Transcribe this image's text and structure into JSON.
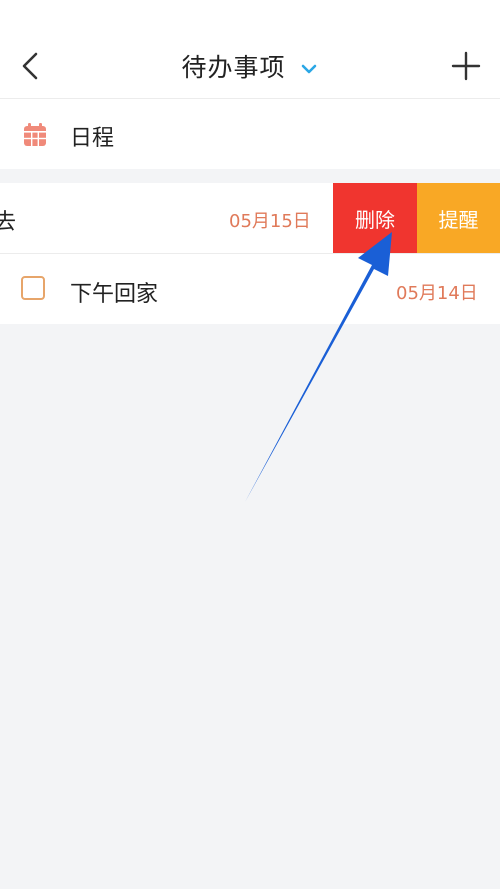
{
  "header": {
    "title": "待办事项",
    "back_icon": "chevron-left-icon",
    "dropdown_icon": "chevron-down-icon",
    "add_icon": "plus-icon"
  },
  "schedule": {
    "label": "日程",
    "icon": "calendar-icon",
    "icon_color": "#f08a7a"
  },
  "tasks": [
    {
      "text": "去",
      "date": "05月15日",
      "swiped": true
    },
    {
      "text": "下午回家",
      "date": "05月14日",
      "swiped": false
    }
  ],
  "swipe_actions": {
    "delete_label": "删除",
    "remind_label": "提醒",
    "delete_color": "#f0352f",
    "remind_color": "#f9a825"
  },
  "colors": {
    "accent": "#2aa7e6",
    "date": "#e07a5a",
    "annotation_arrow": "#1a5fd6"
  }
}
